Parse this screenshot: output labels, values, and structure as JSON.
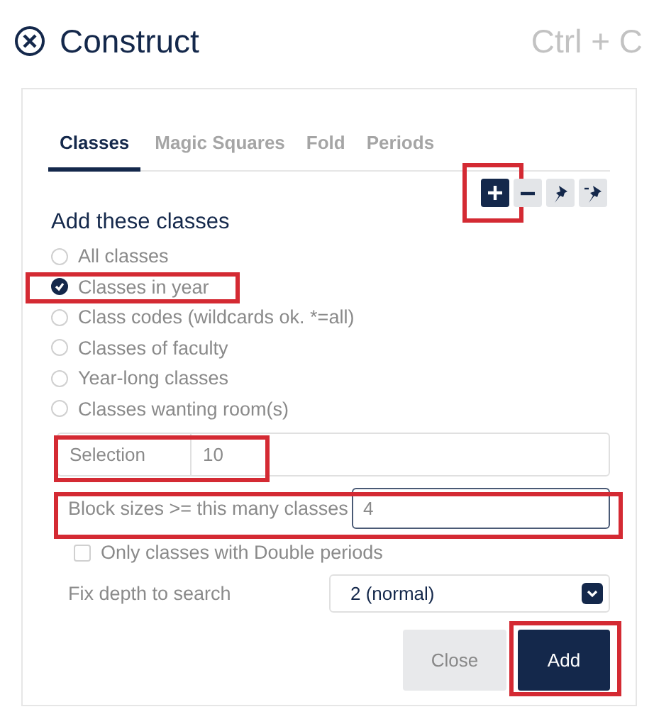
{
  "header": {
    "title": "Construct",
    "shortcut": "Ctrl + C"
  },
  "tabs": [
    {
      "label": "Classes",
      "selected": true
    },
    {
      "label": "Magic Squares",
      "selected": false
    },
    {
      "label": "Fold",
      "selected": false
    },
    {
      "label": "Periods",
      "selected": false
    }
  ],
  "toolbar": [
    {
      "kind": "add",
      "active": true,
      "highlighted": true
    },
    {
      "kind": "remove",
      "active": false,
      "highlighted": false
    },
    {
      "kind": "pin",
      "active": false,
      "highlighted": false
    },
    {
      "kind": "unpin",
      "active": false,
      "highlighted": false
    }
  ],
  "section_title": "Add these classes",
  "options": [
    {
      "label": "All classes",
      "selected": false,
      "highlighted": false
    },
    {
      "label": "Classes in year",
      "selected": true,
      "highlighted": true
    },
    {
      "label": "Class codes (wildcards ok. *=all)",
      "selected": false,
      "highlighted": false
    },
    {
      "label": "Classes of faculty",
      "selected": false,
      "highlighted": false
    },
    {
      "label": "Year-long classes",
      "selected": false,
      "highlighted": false
    },
    {
      "label": "Classes wanting room(s)",
      "selected": false,
      "highlighted": false
    }
  ],
  "selection": {
    "label": "Selection",
    "value": "10",
    "highlighted": true
  },
  "block_sizes": {
    "label": "Block sizes >= this many classes",
    "value": "4",
    "focused": true,
    "highlighted": true
  },
  "double_periods": {
    "label": "Only classes with Double periods",
    "checked": false
  },
  "fix_depth": {
    "label": "Fix depth to search",
    "value": "2 (normal)"
  },
  "buttons": [
    {
      "label": "Close",
      "kind": "secondary",
      "highlighted": false
    },
    {
      "label": "Add",
      "kind": "primary",
      "highlighted": true
    }
  ]
}
